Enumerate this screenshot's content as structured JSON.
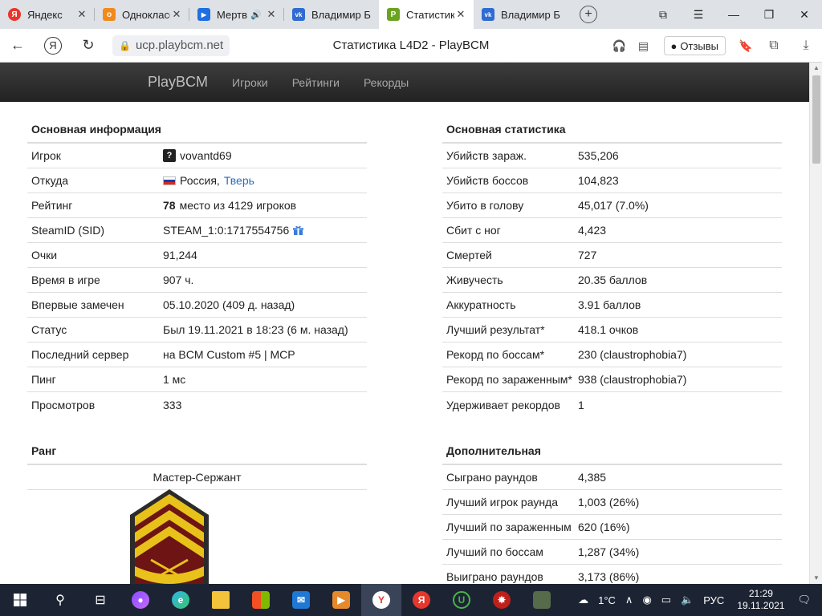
{
  "browser": {
    "tabs": [
      {
        "title": "Яндекс",
        "color": "#e8362c",
        "glyph": "Я",
        "close": "✕"
      },
      {
        "title": "Одноклассн",
        "color": "#f28a1b",
        "glyph": "о",
        "close": "✕"
      },
      {
        "title": "Мертв",
        "color": "#1f6fe0",
        "glyph": "▶",
        "close": "✕"
      },
      {
        "title": "Владимир Б",
        "color": "#2f6bd1",
        "glyph": "vk",
        "close": ""
      },
      {
        "title": "Статистик",
        "color": "#6aa31f",
        "glyph": "P",
        "close": "✕"
      },
      {
        "title": "Владимир Б",
        "color": "#2f6bd1",
        "glyph": "vk",
        "close": ""
      }
    ],
    "url": "ucp.playbcm.net",
    "page_title": "Статистика L4D2 - PlayBCM",
    "reviews_label": "Отзывы"
  },
  "site": {
    "brand": "PlayBCM",
    "nav": [
      "Игроки",
      "Рейтинги",
      "Рекорды"
    ]
  },
  "basic_info": {
    "title": "Основная информация",
    "player_label": "Игрок",
    "player_badge": "?",
    "player_name": "vovantd69",
    "from_label": "Откуда",
    "country": "Россия,",
    "city": "Тверь",
    "rating_label": "Рейтинг",
    "rating_place": "78",
    "rating_rest": "место из 4129 игроков",
    "steam_label": "SteamID (SID)",
    "steam_value": "STEAM_1:0:1717554756",
    "points_label": "Очки",
    "points_value": "91,244",
    "time_label": "Время в игре",
    "time_value": "907 ч.",
    "first_label": "Впервые замечен",
    "first_value": "05.10.2020 (409 д. назад)",
    "status_label": "Статус",
    "status_value": "Был 19.11.2021 в 18:23 (6 м. назад)",
    "server_label": "Последний сервер",
    "server_value": "на BCM Custom #5 | MCP",
    "ping_label": "Пинг",
    "ping_value": "1 мс",
    "views_label": "Просмотров",
    "views_value": "333"
  },
  "rank": {
    "title": "Ранг",
    "name": "Мастер-Сержант"
  },
  "main_stats": {
    "title": "Основная статистика",
    "rows": [
      {
        "k": "Убийств зараж.",
        "v": "535,206"
      },
      {
        "k": "Убийств боссов",
        "v": "104,823"
      },
      {
        "k": "Убито в голову",
        "v": "45,017 (7.0%)"
      },
      {
        "k": "Сбит с ног",
        "v": "4,423"
      },
      {
        "k": "Смертей",
        "v": "727"
      },
      {
        "k": "Живучесть",
        "v": "20.35 баллов"
      },
      {
        "k": "Аккуратность",
        "v": "3.91 баллов"
      },
      {
        "k": "Лучший результат*",
        "v": "418.1 очков"
      },
      {
        "k": "Рекорд по боссам*",
        "v": "230 (claustrophobia7)"
      },
      {
        "k": "Рекорд по зараженным*",
        "v": "938 (claustrophobia7)"
      },
      {
        "k": "Удерживает рекордов",
        "v": "1"
      }
    ]
  },
  "extra_stats": {
    "title": "Дополнительная",
    "rows": [
      {
        "k": "Сыграно раундов",
        "v": "4,385"
      },
      {
        "k": "Лучший игрок раунда",
        "v": "1,003 (26%)"
      },
      {
        "k": "Лучший по зараженным",
        "v": "620 (16%)"
      },
      {
        "k": "Лучший по боссам",
        "v": "1,287 (34%)"
      },
      {
        "k": "Выиграно раундов",
        "v": "3,173 (86%)"
      }
    ]
  },
  "taskbar": {
    "temperature": "1°C",
    "lang": "РУС",
    "time": "21:29",
    "date": "19.11.2021"
  },
  "colors": {
    "nav_bg": "#2b2b2b",
    "link": "#2a6ebd",
    "taskbar_bg": "#1c2433",
    "badge_gold": "#e8c21a",
    "badge_maroon": "#7a1a1a"
  }
}
